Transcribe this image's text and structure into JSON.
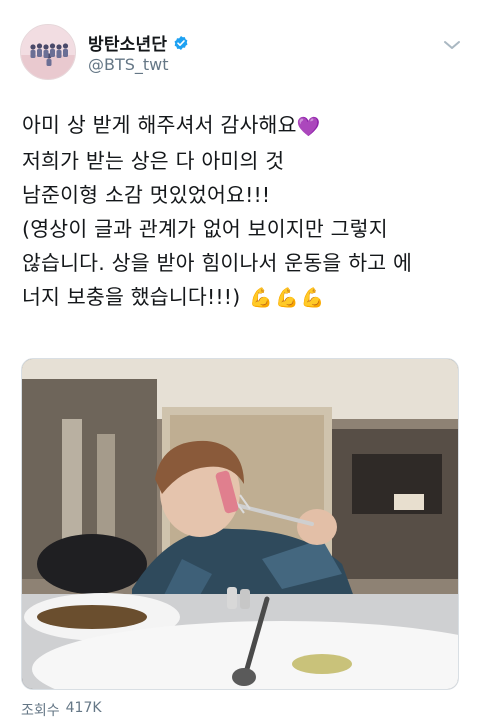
{
  "account": {
    "display_name": "방탄소년단",
    "handle": "@BTS_twt",
    "verified": true,
    "verified_color": "#1da1f2"
  },
  "tweet": {
    "lines": [
      "아미 상 받게 해주셔서 감사해요",
      "저희가 받는 상은 다 아미의 것",
      "남준이형 소감 멋있었어요!!!",
      "(영상이 글과 관계가 없어 보이지만 그렇지",
      "않습니다. 상을 받아 힘이나서 운동을 하고 에",
      "너지 보충을 했습니다!!!)"
    ],
    "heart_emoji": "💜",
    "flex_emojis": [
      "💪",
      "💪",
      "💪"
    ]
  },
  "media": {
    "icon": "video-thumbnail"
  },
  "stats": {
    "views_label": "조회수",
    "views_value": "417K"
  },
  "colors": {
    "text": "#14171a",
    "secondary": "#657786",
    "heart": "#8f49d6",
    "flex": "#f0b51c"
  }
}
